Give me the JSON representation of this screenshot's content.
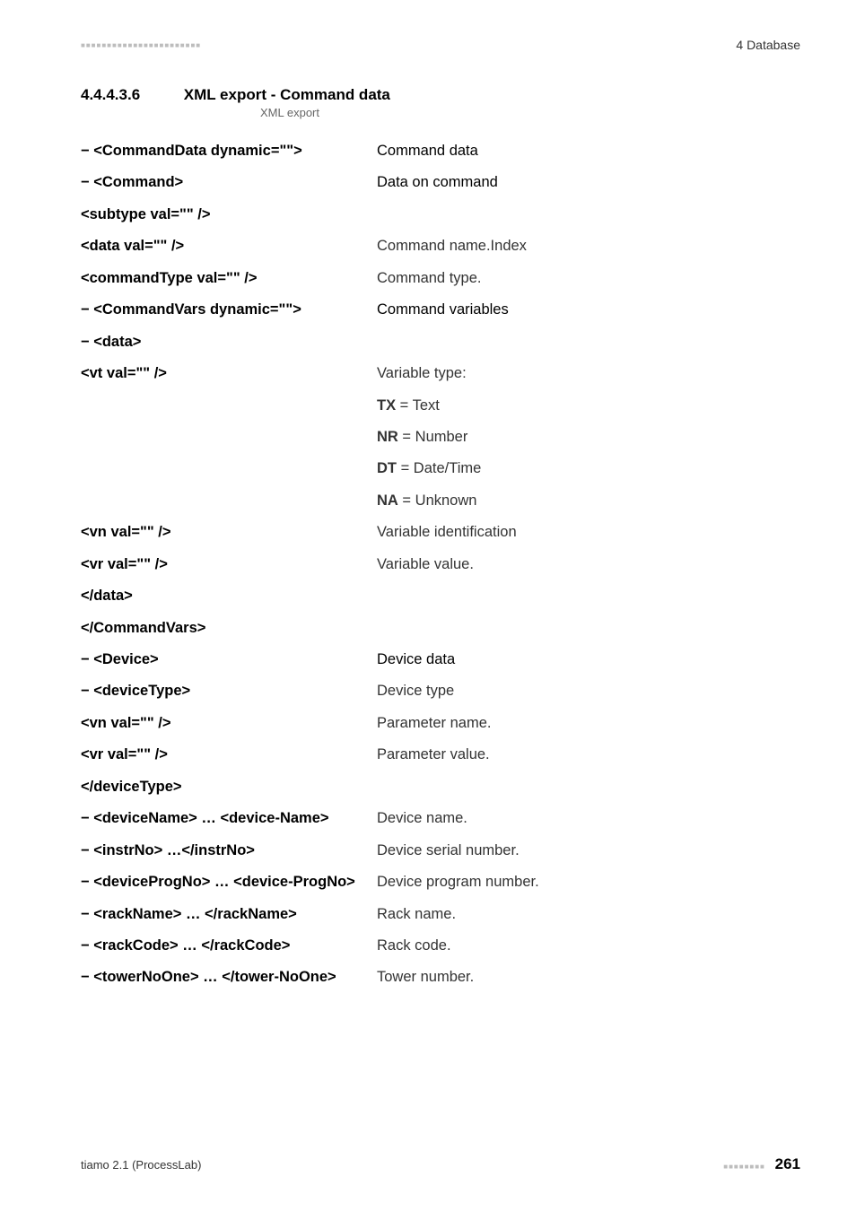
{
  "header": {
    "dots": "■■■■■■■■■■■■■■■■■■■■■■■",
    "right": "4 Database"
  },
  "section": {
    "number": "4.4.4.3.6",
    "title": "XML export - Command data",
    "caption": "XML export"
  },
  "rows": [
    {
      "left": "− <CommandData dynamic=\"\">",
      "right": "Command data",
      "style": "semibold"
    },
    {
      "left": "− <Command>",
      "right": "Data on command",
      "style": "semibold"
    },
    {
      "left": "<subtype val=\"\" />",
      "right": ""
    },
    {
      "left": "<data val=\"\" />",
      "right": "Command name.Index"
    },
    {
      "left": "<commandType val=\"\" />",
      "right": "Command type."
    },
    {
      "left": "− <CommandVars dynamic=\"\">",
      "right": "Command variables",
      "style": "semibold"
    },
    {
      "left": "− <data>",
      "right": ""
    },
    {
      "left": "<vt val=\"\" />",
      "right": "Variable type:"
    },
    {
      "left": "",
      "right_html": "<span class=\"st\">TX</span> = Text"
    },
    {
      "left": "",
      "right_html": "<span class=\"st\">NR</span> = Number"
    },
    {
      "left": "",
      "right_html": "<span class=\"st\">DT</span> = Date/Time"
    },
    {
      "left": "",
      "right_html": "<span class=\"st\">NA</span> = Unknown"
    },
    {
      "left": "<vn val=\"\" />",
      "right": "Variable identification"
    },
    {
      "left": "<vr val=\"\" />",
      "right": "Variable value."
    },
    {
      "left": "</data>",
      "right": ""
    },
    {
      "left": "</CommandVars>",
      "right": ""
    },
    {
      "left": "− <Device>",
      "right": "Device data",
      "style": "semibold"
    },
    {
      "left": "− <deviceType>",
      "right": "Device type"
    },
    {
      "left": "<vn val=\"\" />",
      "right": "Parameter name."
    },
    {
      "left": "<vr val=\"\" />",
      "right": "Parameter value."
    },
    {
      "left": "</deviceType>",
      "right": ""
    },
    {
      "left": "− <deviceName> … <device-Name>",
      "right": "Device name."
    },
    {
      "left": "− <instrNo> …</instrNo>",
      "right": "Device serial number."
    },
    {
      "left": "− <deviceProgNo> … <device-ProgNo>",
      "right": "Device program number."
    },
    {
      "left": "− <rackName> … </rackName>",
      "right": "Rack name."
    },
    {
      "left": "− <rackCode> … </rackCode>",
      "right": "Rack code."
    },
    {
      "left": "− <towerNoOne> … </tower-NoOne>",
      "right": "Tower number."
    }
  ],
  "footer": {
    "left": "tiamo 2.1 (ProcessLab)",
    "dots": "■■■■■■■■",
    "page": "261"
  }
}
